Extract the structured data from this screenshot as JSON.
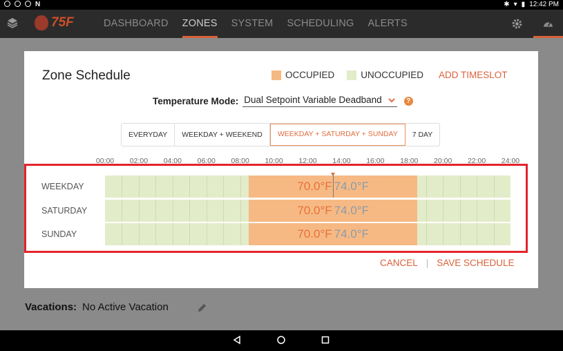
{
  "statusbar": {
    "time": "12:42 PM"
  },
  "app": {
    "logo_text": "75F"
  },
  "nav": {
    "tabs": [
      {
        "label": "DASHBOARD"
      },
      {
        "label": "ZONES"
      },
      {
        "label": "SYSTEM"
      },
      {
        "label": "SCHEDULING"
      },
      {
        "label": "ALERTS"
      }
    ],
    "active_tab": "ZONES"
  },
  "modal": {
    "title": "Zone Schedule",
    "legend": {
      "occupied": "OCCUPIED",
      "unoccupied": "UNOCCUPIED"
    },
    "add_timeslot": "ADD TIMESLOT",
    "temperature_mode": {
      "label": "Temperature Mode:",
      "value": "Dual Setpoint Variable Deadband"
    },
    "segments": [
      {
        "label": "EVERYDAY"
      },
      {
        "label": "WEEKDAY + WEEKEND"
      },
      {
        "label": "WEEKDAY + SATURDAY + SUNDAY"
      },
      {
        "label": "7 DAY"
      }
    ],
    "active_segment": "WEEKDAY + SATURDAY + SUNDAY",
    "hour_ticks": [
      "00:00",
      "02:00",
      "04:00",
      "06:00",
      "08:00",
      "10:00",
      "12:00",
      "14:00",
      "16:00",
      "18:00",
      "20:00",
      "22:00",
      "24:00"
    ],
    "rows": [
      {
        "day": "WEEKDAY",
        "start_hour": 8.5,
        "end_hour": 18.5,
        "heat": "70.0°F",
        "cool": "74.0°F"
      },
      {
        "day": "SATURDAY",
        "start_hour": 8.5,
        "end_hour": 18.5,
        "heat": "70.0°F",
        "cool": "74.0°F"
      },
      {
        "day": "SUNDAY",
        "start_hour": 8.5,
        "end_hour": 18.5,
        "heat": "70.0°F",
        "cool": "74.0°F"
      }
    ],
    "current_hour": 13.5,
    "cancel": "CANCEL",
    "separator": "|",
    "save": "SAVE SCHEDULE"
  },
  "vacation": {
    "label": "Vacations:",
    "value": "No Active Vacation"
  },
  "colors": {
    "accent": "#d8623a",
    "occupied": "#f7b983",
    "unoccupied": "#e3ecc9",
    "highlight": "#e3242b"
  }
}
